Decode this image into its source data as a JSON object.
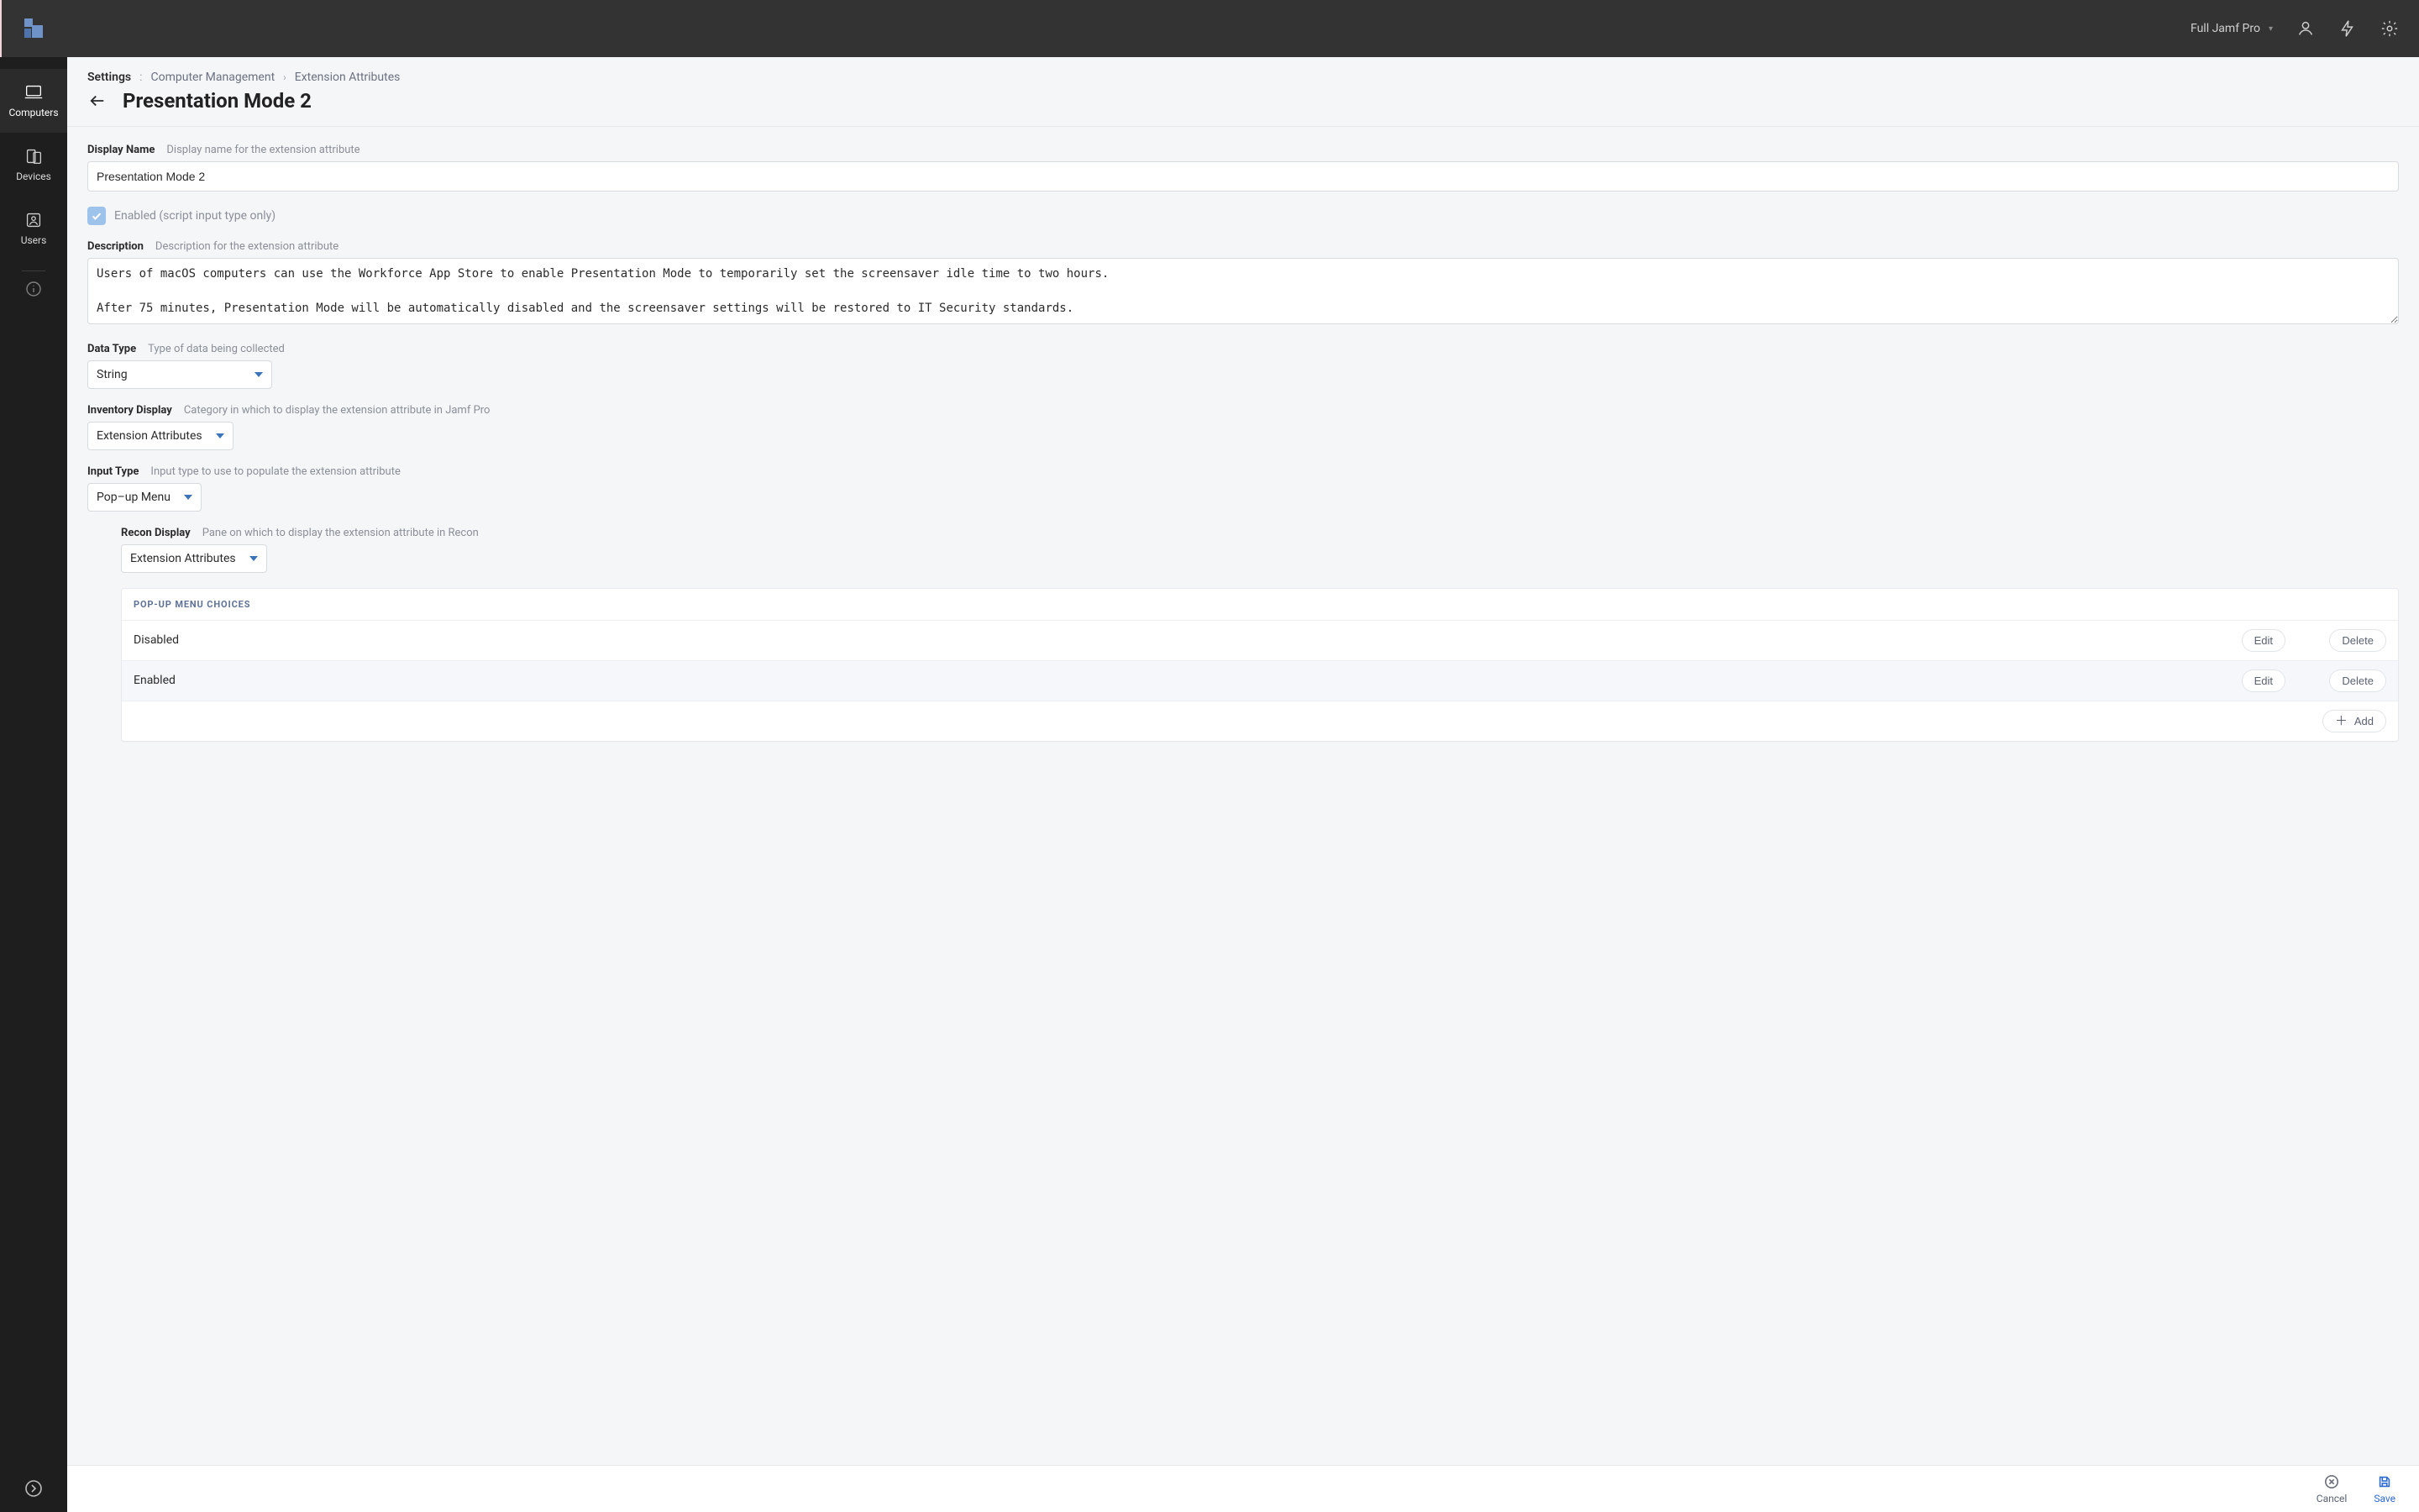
{
  "topbar": {
    "tenant": "Full Jamf Pro"
  },
  "sidebar": {
    "items": [
      {
        "label": "Computers"
      },
      {
        "label": "Devices"
      },
      {
        "label": "Users"
      }
    ]
  },
  "breadcrumbs": {
    "root": "Settings",
    "mid": "Computer Management",
    "leaf": "Extension Attributes"
  },
  "page": {
    "title": "Presentation Mode 2"
  },
  "fields": {
    "display_name": {
      "label": "Display Name",
      "hint": "Display name for the extension attribute",
      "value": "Presentation Mode 2"
    },
    "enabled": {
      "label": "Enabled (script input type only)",
      "checked": true
    },
    "description": {
      "label": "Description",
      "hint": "Description for the extension attribute",
      "value": "Users of macOS computers can use the Workforce App Store to enable Presentation Mode to temporarily set the screensaver idle time to two hours.\n\nAfter 75 minutes, Presentation Mode will be automatically disabled and the screensaver settings will be restored to IT Security standards."
    },
    "data_type": {
      "label": "Data Type",
      "hint": "Type of data being collected",
      "value": "String"
    },
    "inventory_display": {
      "label": "Inventory Display",
      "hint": "Category in which to display the extension attribute in Jamf Pro",
      "value": "Extension Attributes"
    },
    "input_type": {
      "label": "Input Type",
      "hint": "Input type to use to populate the extension attribute",
      "value": "Pop–up Menu"
    },
    "recon_display": {
      "label": "Recon Display",
      "hint": "Pane on which to display the extension attribute in Recon",
      "value": "Extension Attributes"
    }
  },
  "choices": {
    "header": "POP-UP MENU CHOICES",
    "rows": [
      {
        "name": "Disabled",
        "edit": "Edit",
        "delete": "Delete"
      },
      {
        "name": "Enabled",
        "edit": "Edit",
        "delete": "Delete"
      }
    ],
    "add_label": "Add"
  },
  "footer": {
    "cancel": "Cancel",
    "save": "Save"
  }
}
